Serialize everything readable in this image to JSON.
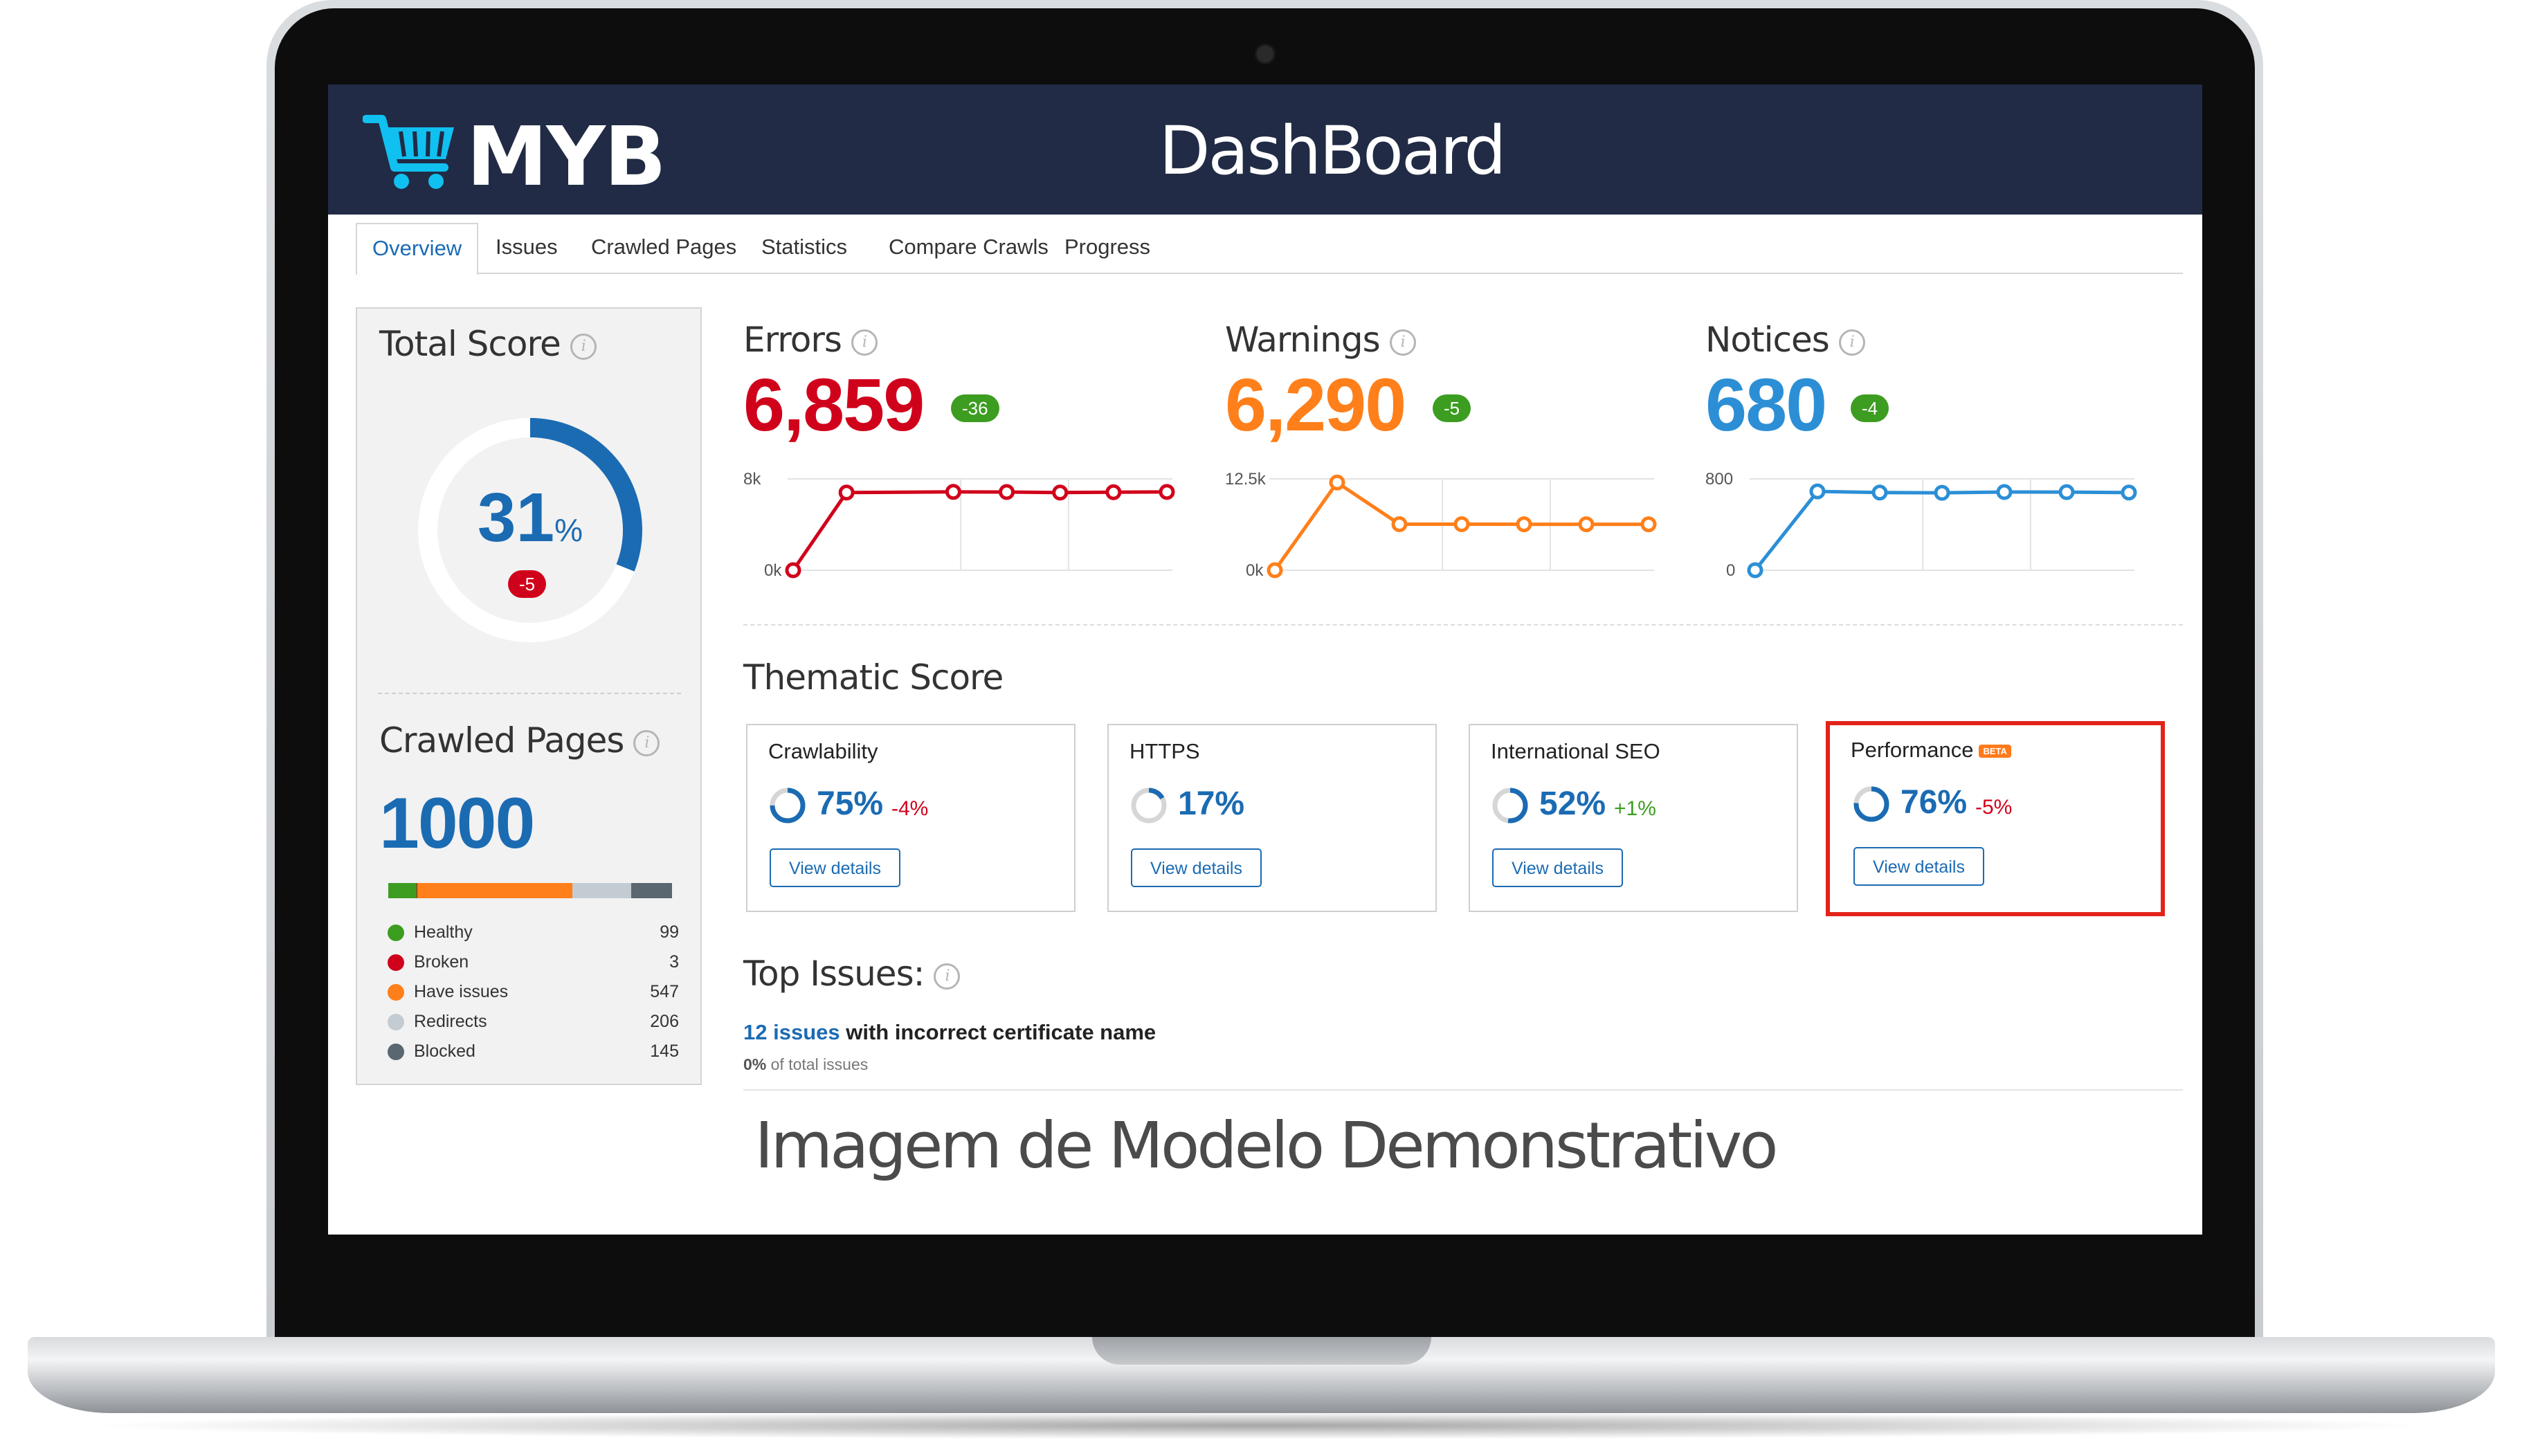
{
  "header": {
    "logo_text": "MYB",
    "title": "DashBoard"
  },
  "tabs": [
    {
      "label": "Overview",
      "active": true
    },
    {
      "label": "Issues"
    },
    {
      "label": "Crawled Pages"
    },
    {
      "label": "Statistics"
    },
    {
      "label": "Compare Crawls"
    },
    {
      "label": "Progress"
    }
  ],
  "total_score": {
    "title": "Total Score",
    "value": "31",
    "unit": "%",
    "delta": "-5",
    "percent": 31
  },
  "crawled_pages": {
    "title": "Crawled Pages",
    "value": "1000",
    "legend": [
      {
        "label": "Healthy",
        "count": "99",
        "color": "#3c9d21"
      },
      {
        "label": "Broken",
        "count": "3",
        "color": "#d0021b"
      },
      {
        "label": "Have issues",
        "count": "547",
        "color": "#ff7f1a"
      },
      {
        "label": "Redirects",
        "count": "206",
        "color": "#c3ccd2"
      },
      {
        "label": "Blocked",
        "count": "145",
        "color": "#5a6670"
      }
    ]
  },
  "metrics": {
    "errors": {
      "label": "Errors",
      "value": "6,859",
      "delta": "-36",
      "color": "#d0021b",
      "y_top_label": "8k",
      "y_bottom_label": "0k"
    },
    "warnings": {
      "label": "Warnings",
      "value": "6,290",
      "delta": "-5",
      "color": "#ff7f1a",
      "y_top_label": "12.5k",
      "y_bottom_label": "0k"
    },
    "notices": {
      "label": "Notices",
      "value": "680",
      "delta": "-4",
      "color": "#2c8fd6",
      "y_top_label": "800",
      "y_bottom_label": "0"
    }
  },
  "chart_data": [
    {
      "type": "line",
      "name": "Errors",
      "ylim": [
        0,
        8000
      ],
      "x": [
        0,
        1,
        3,
        4,
        5,
        6,
        7
      ],
      "values": [
        0,
        6800,
        6860,
        6850,
        6800,
        6830,
        6859
      ]
    },
    {
      "type": "line",
      "name": "Warnings",
      "ylim": [
        0,
        12500
      ],
      "x": [
        0,
        1,
        2,
        3,
        4,
        5,
        6
      ],
      "values": [
        0,
        12000,
        6300,
        6300,
        6290,
        6290,
        6290
      ]
    },
    {
      "type": "line",
      "name": "Notices",
      "ylim": [
        0,
        800
      ],
      "x": [
        0,
        1,
        2,
        3,
        4,
        5,
        6
      ],
      "values": [
        0,
        690,
        680,
        678,
        685,
        684,
        680
      ]
    }
  ],
  "thematic": {
    "title": "Thematic Score",
    "cards": [
      {
        "title": "Crawlability",
        "pct": "75%",
        "percent": 75,
        "delta": "-4%",
        "delta_type": "neg",
        "button": "View details"
      },
      {
        "title": "HTTPS",
        "pct": "17%",
        "percent": 17,
        "delta": "",
        "delta_type": "",
        "button": "View details"
      },
      {
        "title": "International SEO",
        "pct": "52%",
        "percent": 52,
        "delta": "+1%",
        "delta_type": "pos",
        "button": "View details"
      },
      {
        "title": "Performance",
        "badge": "BETA",
        "pct": "76%",
        "percent": 76,
        "delta": "-5%",
        "delta_type": "neg",
        "button": "View details"
      }
    ]
  },
  "top_issues": {
    "title": "Top Issues:",
    "link_text": "12 issues",
    "rest_text": " with incorrect certificate name",
    "sub_pct": "0%",
    "sub_text": " of total issues"
  },
  "watermark": "Imagem de Modelo Demonstrativo",
  "colors": {
    "header_bg": "#212b45",
    "brand_blue": "#1b6bb3",
    "cart_cyan": "#10c0f0"
  }
}
